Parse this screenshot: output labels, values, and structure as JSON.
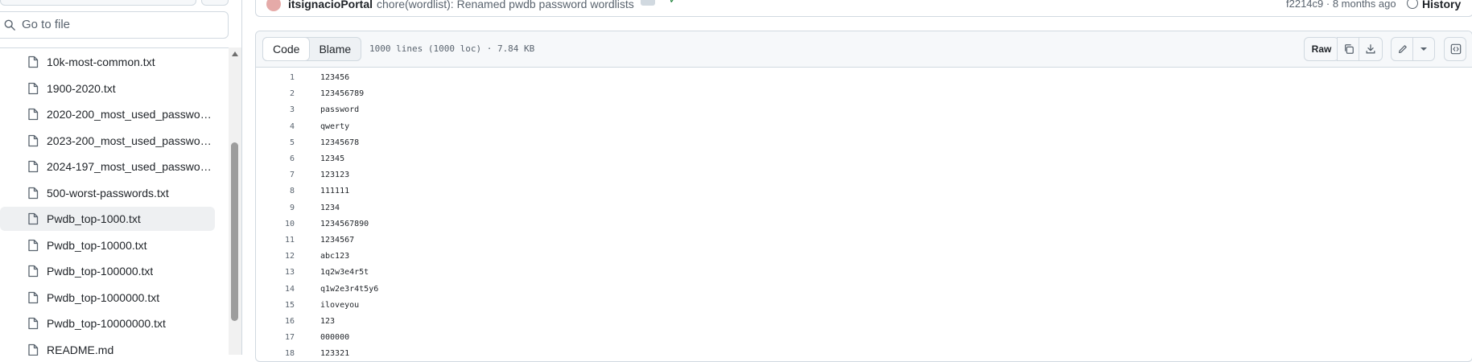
{
  "search": {
    "placeholder": "Go to file"
  },
  "tree": {
    "items": [
      {
        "name": "10k-most-common.txt",
        "active": false
      },
      {
        "name": "1900-2020.txt",
        "active": false
      },
      {
        "name": "2020-200_most_used_passwords.txt",
        "active": false
      },
      {
        "name": "2023-200_most_used_passwords.txt",
        "active": false
      },
      {
        "name": "2024-197_most_used_passwords.txt",
        "active": false
      },
      {
        "name": "500-worst-passwords.txt",
        "active": false
      },
      {
        "name": "Pwdb_top-1000.txt",
        "active": true
      },
      {
        "name": "Pwdb_top-10000.txt",
        "active": false
      },
      {
        "name": "Pwdb_top-100000.txt",
        "active": false
      },
      {
        "name": "Pwdb_top-1000000.txt",
        "active": false
      },
      {
        "name": "Pwdb_top-10000000.txt",
        "active": false
      },
      {
        "name": "README.md",
        "active": false
      }
    ]
  },
  "commit": {
    "author": "itsignacioPortal",
    "message": "chore(wordlist): Renamed pwdb password wordlists",
    "meta": "f2214c9 · 8 months ago",
    "history_label": "History"
  },
  "viewer": {
    "tabs": [
      {
        "label": "Code",
        "selected": true
      },
      {
        "label": "Blame",
        "selected": false
      }
    ],
    "file_info": "1000 lines (1000 loc) · 7.84 KB",
    "raw_label": "Raw",
    "icons": {
      "copy": "copy-icon",
      "download": "download-icon",
      "edit": "pencil-icon",
      "more": "chevron-down-icon",
      "symbols": "code-square-icon"
    }
  },
  "code": {
    "lines": [
      {
        "n": "1",
        "text": "123456"
      },
      {
        "n": "2",
        "text": "123456789"
      },
      {
        "n": "3",
        "text": "password"
      },
      {
        "n": "4",
        "text": "qwerty"
      },
      {
        "n": "5",
        "text": "12345678"
      },
      {
        "n": "6",
        "text": "12345"
      },
      {
        "n": "7",
        "text": "123123"
      },
      {
        "n": "8",
        "text": "111111"
      },
      {
        "n": "9",
        "text": "1234"
      },
      {
        "n": "10",
        "text": "1234567890"
      },
      {
        "n": "11",
        "text": "1234567"
      },
      {
        "n": "12",
        "text": "abc123"
      },
      {
        "n": "13",
        "text": "1q2w3e4r5t"
      },
      {
        "n": "14",
        "text": "q1w2e3r4t5y6"
      },
      {
        "n": "15",
        "text": "iloveyou"
      },
      {
        "n": "16",
        "text": "123"
      },
      {
        "n": "17",
        "text": "000000"
      },
      {
        "n": "18",
        "text": "123321"
      }
    ]
  }
}
